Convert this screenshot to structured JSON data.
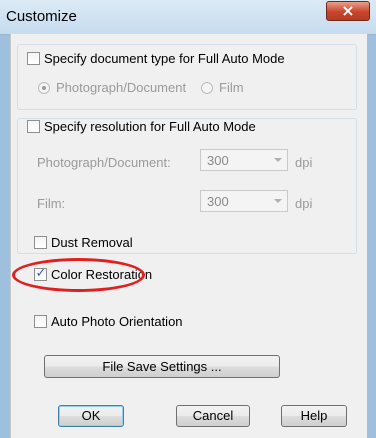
{
  "window": {
    "title": "Customize",
    "close_glyph": "×"
  },
  "full_auto": {
    "document_type_label": "Specify document type for Full Auto Mode",
    "document_type_checked": false,
    "radio_photo_label": "Photograph/Document",
    "radio_film_label": "Film",
    "resolution_label": "Specify resolution for Full Auto Mode",
    "resolution_checked": false,
    "photo_doc_label": "Photograph/Document:",
    "photo_doc_value": "300",
    "film_label": "Film:",
    "film_value": "300",
    "unit": "dpi"
  },
  "options": {
    "dust_removal_label": "Dust Removal",
    "dust_removal_checked": false,
    "color_restoration_label": "Color Restoration",
    "color_restoration_checked": true,
    "color_restoration_mark": "✓",
    "auto_orientation_label": "Auto Photo Orientation",
    "auto_orientation_checked": false
  },
  "buttons": {
    "file_save_settings": "File Save Settings ...",
    "ok": "OK",
    "cancel": "Cancel",
    "help": "Help"
  },
  "annotation": {
    "highlight_color": "#e0201f"
  }
}
